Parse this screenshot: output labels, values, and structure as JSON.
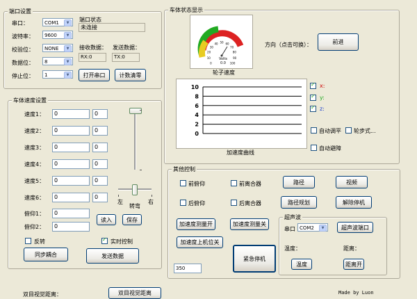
{
  "serial_settings": {
    "title": "端口设置",
    "port_label": "串口：",
    "port_value": "COM1",
    "baud_label": "波特率：",
    "baud_value": "9600",
    "parity_label": "校验位：",
    "parity_value": "NONE",
    "databits_label": "数据位：",
    "databits_value": "8",
    "stopbits_label": "停止位：",
    "stopbits_value": "1",
    "status_label": "端口状态",
    "status_value": "未连接",
    "recv_label": "接收数据：",
    "recv_value": "RX:0",
    "send_label": "发送数据：",
    "send_value": "TX:0",
    "open_button": "打开串口",
    "clear_button": "计数清零"
  },
  "speed_settings": {
    "title": "车体速度设置",
    "rows": [
      {
        "label": "速度1：",
        "value": "0",
        "small": "0"
      },
      {
        "label": "速度2：",
        "value": "0",
        "small": "0"
      },
      {
        "label": "速度3：",
        "value": "0",
        "small": "0"
      },
      {
        "label": "速度4：",
        "value": "0",
        "small": "0"
      },
      {
        "label": "速度5：",
        "value": "0",
        "small": "0"
      },
      {
        "label": "速度6：",
        "value": "0",
        "small": "0"
      }
    ],
    "pitch1_label": "俯仰1：",
    "pitch1_value": "0",
    "pitch2_label": "俯仰2：",
    "pitch2_value": "0",
    "read_button": "读入",
    "save_button": "保存",
    "left_label": "左",
    "right_label": "右",
    "turn_label": "转弯",
    "reverse_label": "反转",
    "reverse_checked": false,
    "realtime_label": "实时控制",
    "realtime_checked": true,
    "sync_button": "同步耦合",
    "send_button": "发送数据"
  },
  "vehicle_status": {
    "title": "车体状态显示",
    "gauge_caption": "轮子速度",
    "gauge_ticks": [
      "0",
      "10",
      "20",
      "30",
      "40",
      "50",
      "60",
      "70",
      "80",
      "90",
      "100"
    ],
    "gauge_unit": "Volts",
    "gauge_value_text": "0.0",
    "direction_label": "方向（点击可换）：",
    "direction_button": "前进",
    "chart_caption": "加速度曲线",
    "series_checks": [
      {
        "label": "x:",
        "checked": true,
        "color": "#cc0000"
      },
      {
        "label": "y:",
        "checked": true,
        "color": "#22aa22"
      },
      {
        "label": "z:",
        "checked": true,
        "color": "#2244cc"
      }
    ],
    "auto_adjust_label": "自动调平",
    "auto_adjust_checked": false,
    "wheel_step_label": "轮步式...",
    "wheel_step_checked": false,
    "auto_avoid_label": "自动避障",
    "auto_avoid_checked": false
  },
  "chart_data": {
    "type": "line",
    "y_ticks": [
      10,
      8,
      6,
      4,
      2,
      0
    ],
    "ylim": [
      0,
      10
    ],
    "series": []
  },
  "other_controls": {
    "title": "其他控制",
    "front_pitch": "前俯仰",
    "front_clutch": "前离合器",
    "rear_pitch": "后俯仰",
    "rear_clutch": "后离合器",
    "path_button": "路径",
    "video_button": "视频",
    "path_plan_button": "路径规划",
    "release_stop_button": "解除停机",
    "accel_on_button": "加速度测量开",
    "accel_off_button": "加速度测量关",
    "accel_upper_button": "加速度上机位关",
    "estop_button": "紧急停机",
    "value_field": "350"
  },
  "ultrasonic": {
    "title": "超声波",
    "port_label": "串口",
    "port_value": "COM2",
    "port_button": "超声波端口",
    "temp_label": "温度：",
    "distance_label": "距离：",
    "temp_button": "温度",
    "distance_button": "距离开"
  },
  "footer": {
    "stereo_label": "双目视觉距离：",
    "stereo_button": "双目视觉距离",
    "credit": "Made by Luon"
  }
}
